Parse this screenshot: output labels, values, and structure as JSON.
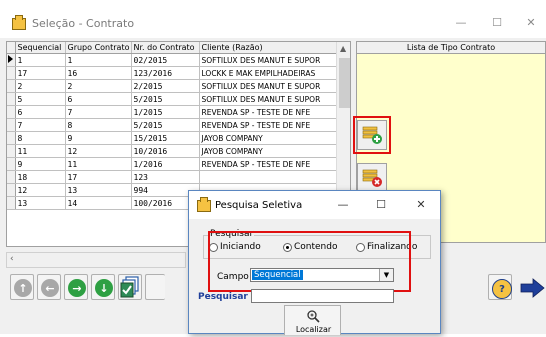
{
  "window": {
    "title": "Seleção - Contrato",
    "min_glyph": "—",
    "max_glyph": "☐",
    "close_glyph": "✕"
  },
  "grid": {
    "columns": [
      "Sequencial",
      "Grupo Contrato",
      "Nr. do Contrato",
      "Cliente (Razão)"
    ],
    "rows": [
      [
        "1",
        "1",
        "02/2015",
        "SOFTILUX DES MANUT E SUPOR"
      ],
      [
        "17",
        "16",
        "123/2016",
        "LOCKK E MAK EMPILHADEIRAS"
      ],
      [
        "2",
        "2",
        "2/2015",
        "SOFTILUX DES MANUT E SUPOR"
      ],
      [
        "5",
        "6",
        "5/2015",
        "SOFTILUX DES MANUT E SUPOR"
      ],
      [
        "6",
        "7",
        "1/2015",
        "REVENDA SP - TESTE DE NFE"
      ],
      [
        "7",
        "8",
        "5/2015",
        "REVENDA SP - TESTE DE NFE"
      ],
      [
        "8",
        "9",
        "15/2015",
        "JAYOB COMPANY"
      ],
      [
        "11",
        "12",
        "10/2016",
        "JAYOB COMPANY"
      ],
      [
        "9",
        "11",
        "1/2016",
        "REVENDA SP - TESTE DE NFE"
      ],
      [
        "18",
        "17",
        "123",
        ""
      ],
      [
        "12",
        "13",
        "994",
        ""
      ],
      [
        "13",
        "14",
        "100/2016",
        ""
      ]
    ]
  },
  "list_panel": {
    "header": "Lista de Tipo Contrato"
  },
  "dialog": {
    "title": "Pesquisa Seletiva",
    "group_label": "Pesquisar",
    "options": [
      "Iniciando",
      "Contendo",
      "Finalizando"
    ],
    "selected_option": "Contendo",
    "campo_label": "Campo",
    "campo_value": "Sequencial",
    "pesquisar_label": "Pesquisar",
    "pesquisar_value": "",
    "localizar_label": "Localizar"
  },
  "colors": {
    "highlight_red": "#e01010",
    "selection_blue": "#0078d7",
    "list_bg": "#ffffcc"
  }
}
